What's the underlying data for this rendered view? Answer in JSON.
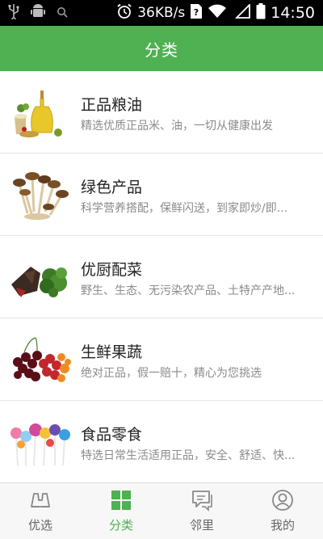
{
  "status_bar": {
    "network_speed": "36KB/s",
    "time": "14:50"
  },
  "header": {
    "title": "分类"
  },
  "categories": [
    {
      "title": "正品粮油",
      "desc": "精选优质正品米、油，一切从健康出发",
      "icon": "grain-oil-image"
    },
    {
      "title": "绿色产品",
      "desc": "科学营养搭配，保鲜闪送，到家即炒/即...",
      "icon": "mushroom-image"
    },
    {
      "title": "优厨配菜",
      "desc": "野生、生态、无污染农产品、土特产产地...",
      "icon": "vegetables-image"
    },
    {
      "title": "生鲜果蔬",
      "desc": "绝对正品，假一赔十，精心为您挑选",
      "icon": "cherries-image"
    },
    {
      "title": "食品零食",
      "desc": "特选日常生活适用正品，安全、舒适、快...",
      "icon": "lollipops-image"
    }
  ],
  "bottom_nav": [
    {
      "label": "优选",
      "icon": "binoculars-icon",
      "active": false
    },
    {
      "label": "分类",
      "icon": "grid-icon",
      "active": true
    },
    {
      "label": "邻里",
      "icon": "chat-icon",
      "active": false
    },
    {
      "label": "我的",
      "icon": "user-icon",
      "active": false
    }
  ],
  "colors": {
    "accent": "#4fb152",
    "title_text": "#222222",
    "desc_text": "#8a8a8a"
  }
}
